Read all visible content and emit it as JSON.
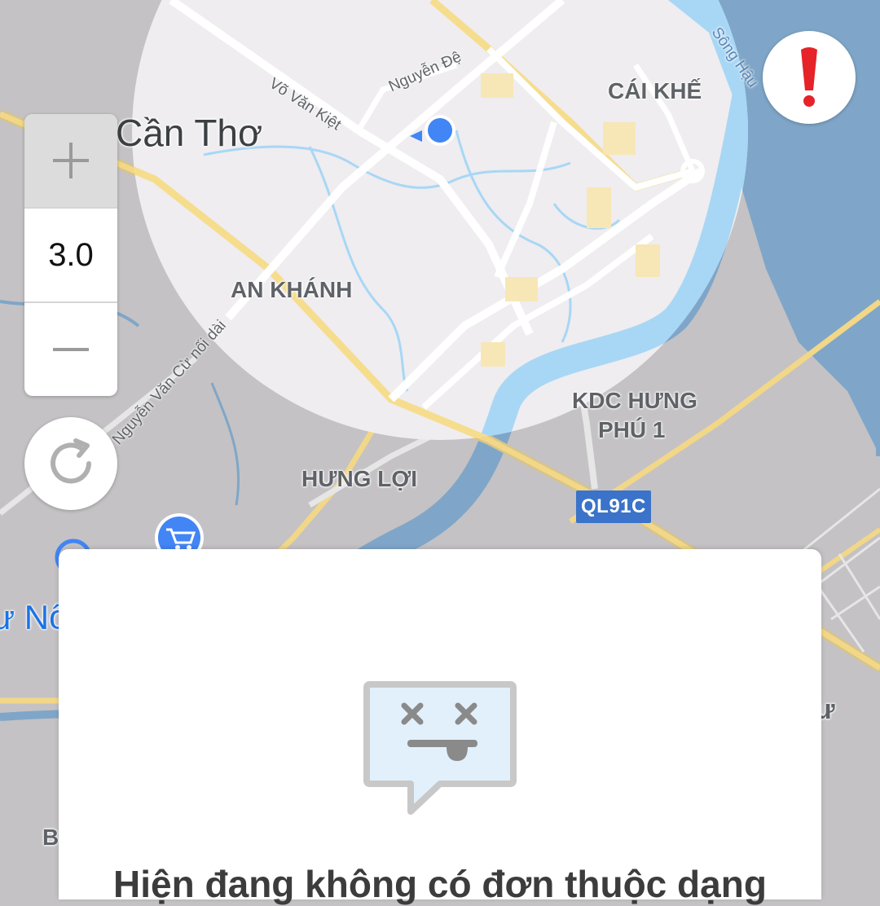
{
  "map": {
    "city_label": "Cần Thơ",
    "districts": [
      "CÁI KHẾ",
      "AN KHÁNH",
      "KDC HƯNG",
      "PHÚ 1",
      "HƯNG LỢI"
    ],
    "streets": [
      "Võ Văn Kiệt",
      "Nguyễn Đệ",
      "Nguyễn Văn Cừ nối dài",
      "Sông Hậu"
    ],
    "road_badge": "QL91C",
    "edge_labels": {
      "left_place": "ư Nổ",
      "right_place": "ư",
      "bottom_left": "B"
    },
    "colors": {
      "water": "#a8d7f5",
      "highway": "#f3d680",
      "land": "#c4c2c4",
      "accent": "#4285f4",
      "alert": "#e52329"
    }
  },
  "zoom_control": {
    "plus_icon": "plus-icon",
    "level": "3.0",
    "minus_icon": "minus-icon"
  },
  "refresh_button": {
    "icon": "refresh-icon"
  },
  "alert_button": {
    "icon": "exclamation-icon"
  },
  "empty_state": {
    "icon": "sad-chat-bubble-icon",
    "title": "Hiện đang không có đơn thuộc dạng"
  }
}
